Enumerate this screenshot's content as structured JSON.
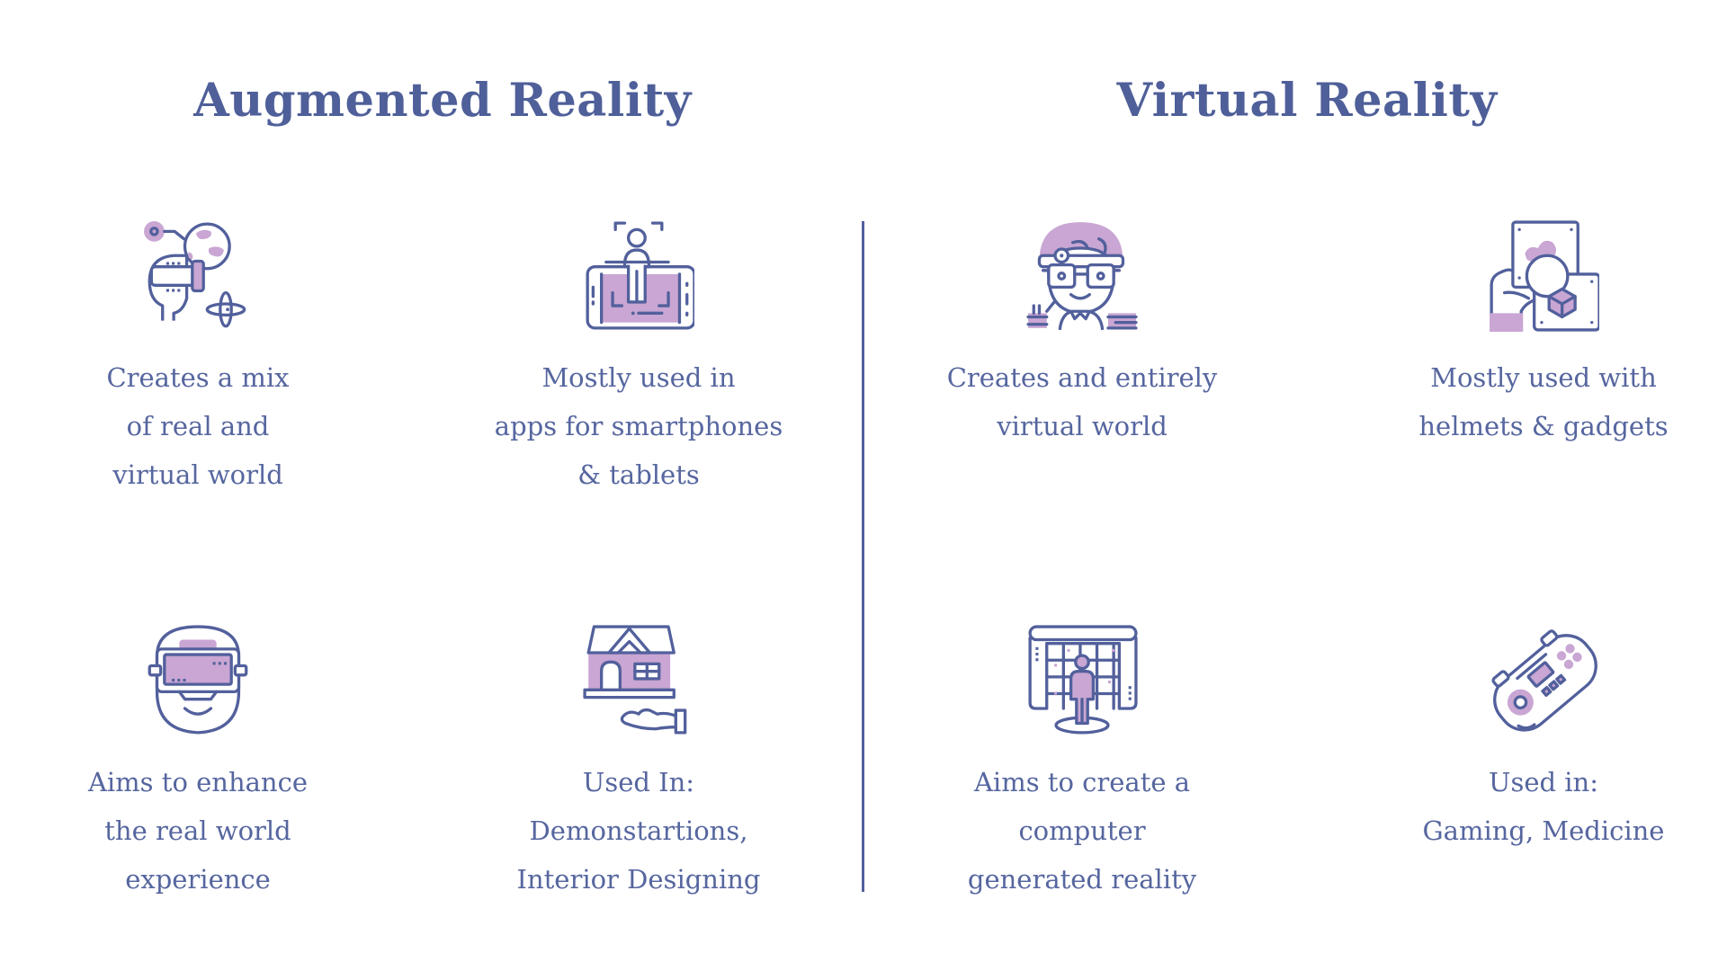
{
  "headings": {
    "augmented": "Augmented Reality",
    "virtual": "Virtual Reality"
  },
  "colors": {
    "primary": "#52609c",
    "accent": "#c9a6d3",
    "heading": "#4f5f99",
    "text": "#56669f",
    "background": "#ffffff"
  },
  "augmented": {
    "cards": [
      {
        "icon": "vr-headset-head-globe-icon",
        "lines": [
          "Creates a mix",
          "of real and",
          "virtual world"
        ]
      },
      {
        "icon": "smartphone-ar-person-icon",
        "lines": [
          "Mostly used in",
          "apps for smartphones",
          "& tablets"
        ]
      },
      {
        "icon": "ar-glasses-face-icon",
        "lines": [
          "Aims to enhance",
          "the real world",
          "experience"
        ]
      },
      {
        "icon": "house-on-hand-icon",
        "lines": [
          "Used In:",
          "Demonstartions,",
          "Interior Designing"
        ]
      }
    ]
  },
  "virtual": {
    "cards": [
      {
        "icon": "boy-with-vr-glasses-icon",
        "lines": [
          "Creates and entirely",
          "virtual world"
        ]
      },
      {
        "icon": "hand-holding-vr-cube-icon",
        "lines": [
          "Mostly used with",
          "helmets & gadgets"
        ]
      },
      {
        "icon": "person-in-vr-room-icon",
        "lines": [
          "Aims to create a",
          "computer",
          "generated reality"
        ]
      },
      {
        "icon": "game-controller-icon",
        "lines": [
          "Used in:",
          "Gaming, Medicine"
        ]
      }
    ]
  }
}
